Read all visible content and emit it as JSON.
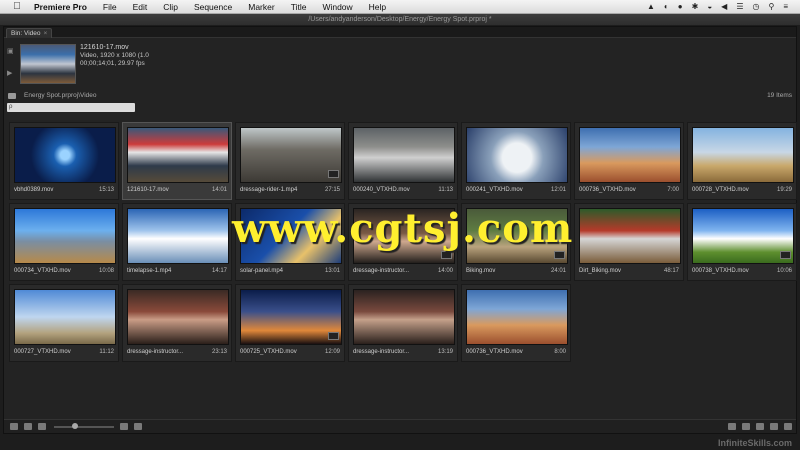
{
  "menubar": {
    "apple": "",
    "app_name": "Premiere Pro",
    "items": [
      "File",
      "Edit",
      "Clip",
      "Sequence",
      "Marker",
      "Title",
      "Window",
      "Help"
    ]
  },
  "window": {
    "title": "/Users/andyanderson/Desktop/Energy/Energy Spot.prproj *"
  },
  "panel": {
    "tab_label": "Bin: Video",
    "tab_close": "×"
  },
  "preview": {
    "clip_name": "121610-17.mov",
    "line2": "Video, 1920 x 1080 (1.0",
    "line3": "00;00;14;01, 29.97 fps"
  },
  "path": {
    "text": "Energy Spot.prproj\\Video",
    "count": "19 Items"
  },
  "search": {
    "placeholder": "ρ"
  },
  "items": [
    {
      "name": "vbhd0389.mov",
      "dur": "15:13"
    },
    {
      "name": "121610-17.mov",
      "dur": "14:01"
    },
    {
      "name": "dressage-rider-1.mp4",
      "dur": "27:15"
    },
    {
      "name": "000240_VTXHD.mov",
      "dur": "11:13"
    },
    {
      "name": "000241_VTXHD.mov",
      "dur": "12:01"
    },
    {
      "name": "000736_VTXHD.mov",
      "dur": "7:00"
    },
    {
      "name": "000728_VTXHD.mov",
      "dur": "19:29"
    },
    {
      "name": "000734_VTXHD.mov",
      "dur": "10:08"
    },
    {
      "name": "timelapse-1.mp4",
      "dur": "14:17"
    },
    {
      "name": "solar-panel.mp4",
      "dur": "13:01"
    },
    {
      "name": "dressage-instructor...",
      "dur": "14:00"
    },
    {
      "name": "Biking.mov",
      "dur": "24:01"
    },
    {
      "name": "Dirt_Biking.mov",
      "dur": "48:17"
    },
    {
      "name": "000738_VTXHD.mov",
      "dur": "10:06"
    },
    {
      "name": "000727_VTXHD.mov",
      "dur": "11:12"
    },
    {
      "name": "dressage-instructor...",
      "dur": "23:13"
    },
    {
      "name": "000725_VTXHD.mov",
      "dur": "12:09"
    },
    {
      "name": "dressage-instructor...",
      "dur": "13:19"
    },
    {
      "name": "000736_VTXHD.mov",
      "dur": "8:00"
    }
  ],
  "watermark": "www.cgtsj.com",
  "footer_brand": "InfiniteSkills.com"
}
